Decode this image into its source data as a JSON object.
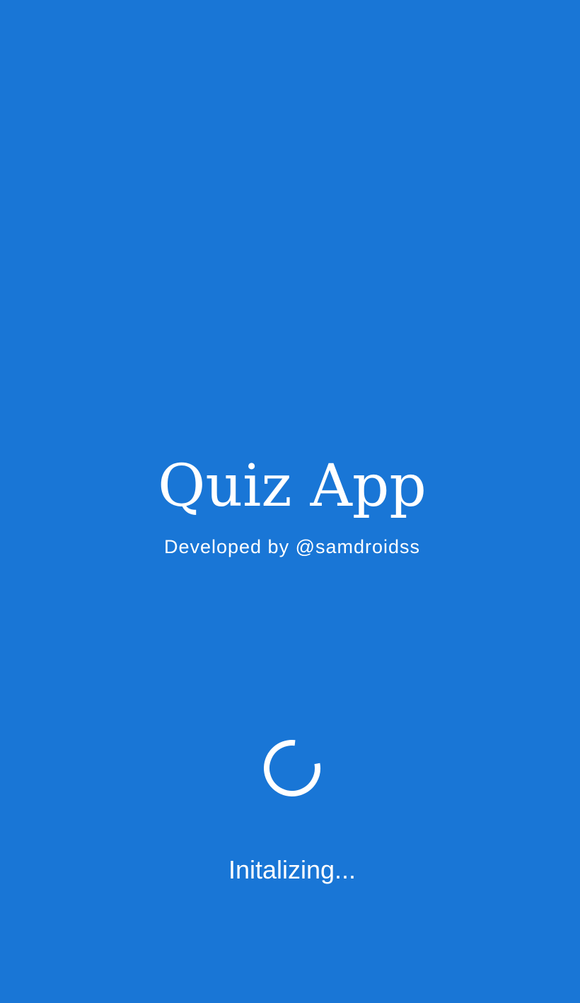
{
  "splash": {
    "title": "Quiz App",
    "credit": "Developed by @samdroidss",
    "status": "Initalizing...",
    "loading_icon": "progress-spinner-icon",
    "colors": {
      "background": "#1976d6",
      "text": "#ffffff",
      "spinner": "#ffffff"
    }
  }
}
